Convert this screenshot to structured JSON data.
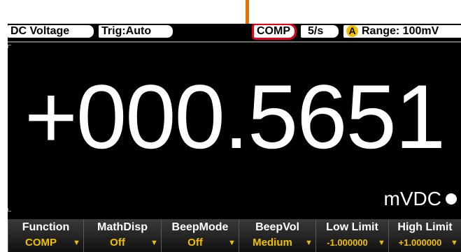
{
  "status": {
    "mode": "DC Voltage",
    "trigger": "Trig:Auto",
    "comp": "COMP",
    "rate": "5/s",
    "range_badge": "A",
    "range": "Range: 100mV"
  },
  "reading": {
    "value": "+000.5651",
    "unit": "mVDC"
  },
  "softkeys": [
    {
      "label": "Function",
      "value": "COMP"
    },
    {
      "label": "MathDisp",
      "value": "Off"
    },
    {
      "label": "BeepMode",
      "value": "Off"
    },
    {
      "label": "BeepVol",
      "value": "Medium"
    },
    {
      "label": "Low Limit",
      "value": "-1.000000"
    },
    {
      "label": "High Limit",
      "value": "+1.000000"
    }
  ],
  "colors": {
    "accent": "#f0c000",
    "highlight": "#e3001b",
    "callout": "#f06a00"
  },
  "icons": {
    "softkey_chevron": "chevron-down-icon",
    "unit_indicator": "status-dot-icon"
  }
}
